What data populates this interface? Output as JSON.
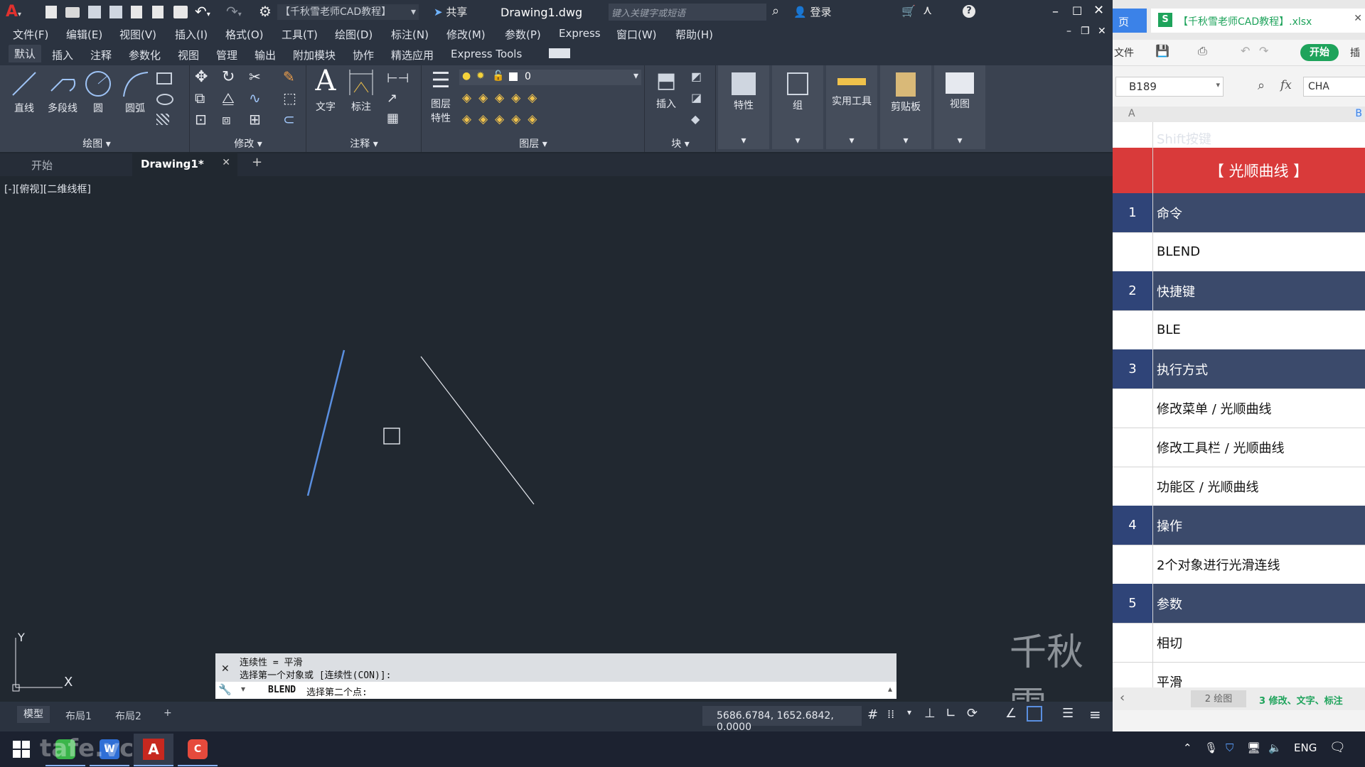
{
  "cad": {
    "title": {
      "workspace": "【千秋雪老师CAD教程】",
      "share": "共享",
      "filename": "Drawing1.dwg",
      "search_placeholder": "键入关键字或短语",
      "login": "登录"
    },
    "menu": [
      "文件(F)",
      "编辑(E)",
      "视图(V)",
      "插入(I)",
      "格式(O)",
      "工具(T)",
      "绘图(D)",
      "标注(N)",
      "修改(M)",
      "参数(P)",
      "Express",
      "窗口(W)",
      "帮助(H)"
    ],
    "ribbon_tabs": [
      "默认",
      "插入",
      "注释",
      "参数化",
      "视图",
      "管理",
      "输出",
      "附加模块",
      "协作",
      "精选应用",
      "Express Tools"
    ],
    "active_ribbon_tab": "默认",
    "draw_panel": {
      "line": "直线",
      "polyline": "多段线",
      "circle": "圆",
      "arc": "圆弧",
      "title": "绘图"
    },
    "modify_panel": {
      "title": "修改"
    },
    "annotation_panel": {
      "text": "文字",
      "dimension": "标注",
      "title": "注释"
    },
    "layer_panel": {
      "layer_props_line1": "图层",
      "layer_props_line2": "特性",
      "current_layer": "0",
      "title": "图层"
    },
    "block_panel": {
      "insert": "插入",
      "title": "块"
    },
    "big_buttons": [
      "特性",
      "组",
      "实用工具",
      "剪贴板",
      "视图"
    ],
    "doc_tabs": {
      "start": "开始",
      "current": "Drawing1*",
      "add": "+"
    },
    "viewport_label": "[-][俯视][二维线框]",
    "ucs": {
      "x": "X",
      "y": "Y"
    },
    "command": {
      "history1": "连续性 = 平滑",
      "history2": "选择第一个对象或 [连续性(CON)]:",
      "current_cmd": "BLEND",
      "prompt": "选择第二个点:"
    },
    "layout_tabs": [
      "模型",
      "布局1",
      "布局2"
    ],
    "coords": "5686.6784, 1652.6842, 0.0000",
    "watermark": "千秋雪"
  },
  "excel": {
    "tab_left": "页",
    "file_title": "【千秋雪老师CAD教程】.xlsx",
    "menu_file": "文件",
    "start_btn": "开始",
    "insert_cut": "插",
    "cell_ref": "B189",
    "fx": "fx",
    "formula_value": "CHA",
    "col_a": "A",
    "col_b": "B",
    "top_partial": "Shift按键",
    "header": "【 光顺曲线 】",
    "rows": [
      {
        "num": "1",
        "text": "命令",
        "section": true
      },
      {
        "num": "",
        "text": "BLEND",
        "section": false
      },
      {
        "num": "2",
        "text": "快捷键",
        "section": true
      },
      {
        "num": "",
        "text": "BLE",
        "section": false
      },
      {
        "num": "3",
        "text": "执行方式",
        "section": true
      },
      {
        "num": "",
        "text": "修改菜单 / 光顺曲线",
        "section": false
      },
      {
        "num": "",
        "text": "修改工具栏 / 光顺曲线",
        "section": false
      },
      {
        "num": "",
        "text": "功能区 / 光顺曲线",
        "section": false
      },
      {
        "num": "4",
        "text": "操作",
        "section": true
      },
      {
        "num": "",
        "text": "2个对象进行光滑连线",
        "section": false
      },
      {
        "num": "5",
        "text": "参数",
        "section": true
      },
      {
        "num": "",
        "text": "相切",
        "section": false
      },
      {
        "num": "",
        "text": "平滑",
        "section": false
      }
    ],
    "sheet_tabs": [
      "2 绘图",
      "3 修改、文字、标注"
    ]
  },
  "taskbar": {
    "lang": "ENG",
    "watermark_text": "tafe.vc"
  },
  "colors": {
    "excel_header": "#d93a3a",
    "excel_section": "#3b4a6b",
    "cad_accent": "#5a8fe0"
  }
}
